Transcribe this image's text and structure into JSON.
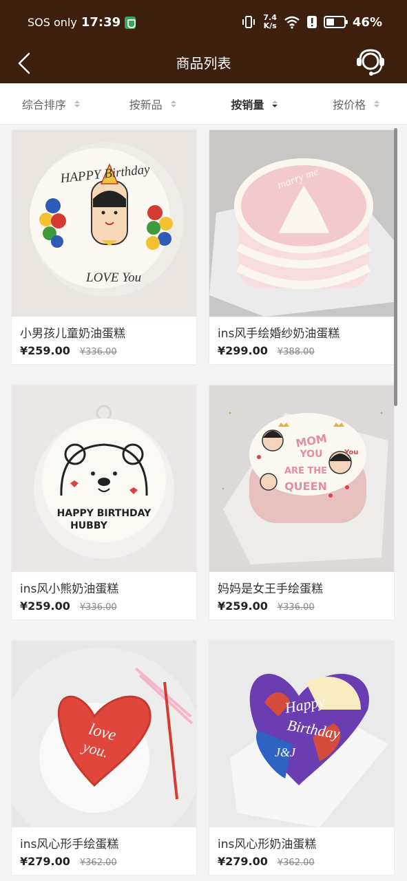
{
  "status": {
    "sos": "SOS only",
    "time": "17:39",
    "speed_value": "7.4",
    "speed_unit": "K/s",
    "battery": "46%",
    "battery_level": 0.46
  },
  "nav": {
    "title": "商品列表"
  },
  "sort": {
    "items": [
      {
        "label": "综合排序"
      },
      {
        "label": "按新品"
      },
      {
        "label": "按销量"
      },
      {
        "label": "按价格"
      }
    ],
    "active": "按销量"
  },
  "products": [
    {
      "name": "小男孩儿童奶油蛋糕",
      "price": "¥259.00",
      "original_price": "¥336.00"
    },
    {
      "name": "ins风手绘婚纱奶油蛋糕",
      "price": "¥299.00",
      "original_price": "¥388.00"
    },
    {
      "name": "ins风小熊奶油蛋糕",
      "price": "¥259.00",
      "original_price": "¥336.00"
    },
    {
      "name": "妈妈是女王手绘蛋糕",
      "price": "¥259.00",
      "original_price": "¥336.00"
    },
    {
      "name": "ins风心形手绘蛋糕",
      "price": "¥279.00",
      "original_price": "¥362.00"
    },
    {
      "name": "ins风心形奶油蛋糕",
      "price": "¥279.00",
      "original_price": "¥362.00"
    }
  ],
  "cake_text": {
    "c1_top": "HAPPY Birthday",
    "c1_bottom": "LOVE You",
    "c2": "marry me",
    "c3_line1": "HAPPY BIRTHDAY",
    "c3_line2": "HUBBY",
    "c4_line1": "MOM",
    "c4_line2": "YOU",
    "c4_line3": "ARE THE",
    "c4_line4": "QUEEN",
    "c4_you": "You",
    "c5_line1": "love",
    "c5_line2": "you.",
    "c6_line1": "Happy",
    "c6_line2": "Birthday",
    "c6_line3": "J&J"
  }
}
